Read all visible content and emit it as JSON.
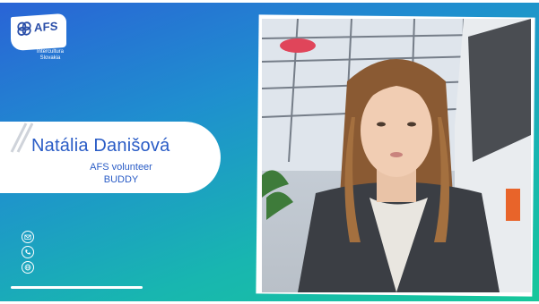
{
  "brand": {
    "logo_text": "AFS",
    "logo_sub_line1": "Intercultura",
    "logo_sub_line2": "Slovakia",
    "color_primary": "#2a5cc6",
    "color_gradient_start": "#2a63d6",
    "color_gradient_end": "#16c79a"
  },
  "speaker": {
    "name": "Natália Danišová",
    "role_line1": "AFS volunteer",
    "role_line2": "BUDDY"
  },
  "contacts": [
    {
      "icon": "mail-icon"
    },
    {
      "icon": "phone-icon"
    },
    {
      "icon": "globe-icon"
    }
  ],
  "video": {
    "content": "webcam-feed",
    "progress": 0.25
  }
}
